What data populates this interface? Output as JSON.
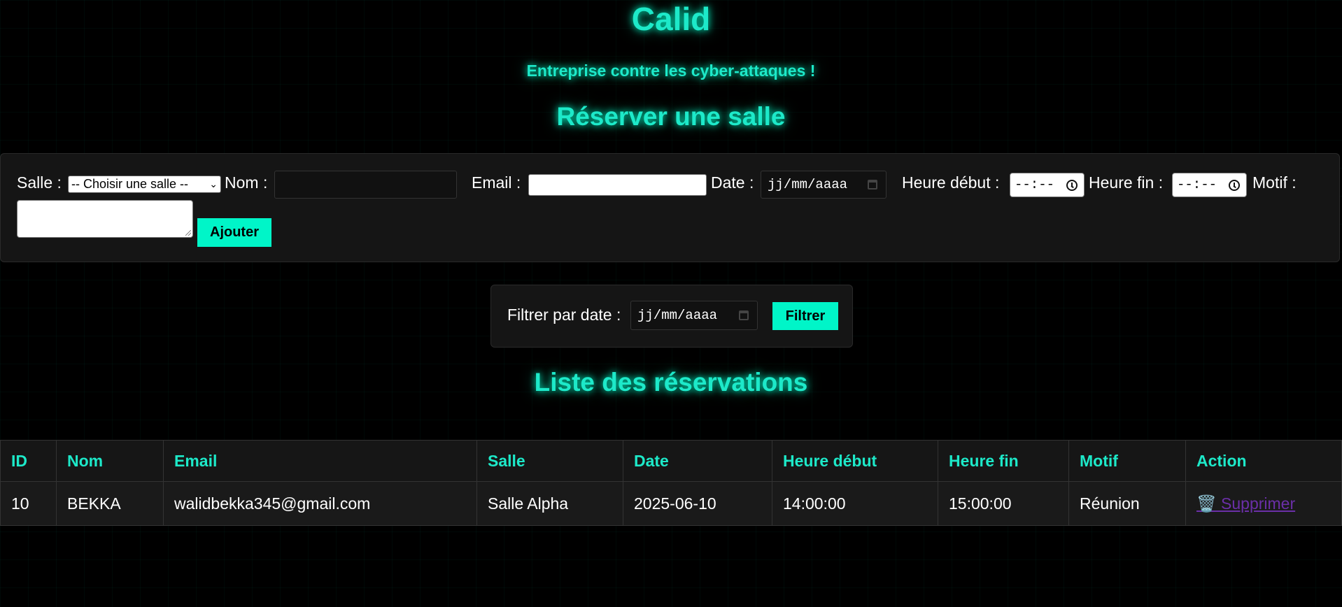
{
  "header": {
    "title": "Calid",
    "subtitle": "Entreprise contre les cyber-attaques !",
    "reserve_heading": "Réserver une salle",
    "list_heading": "Liste des réservations"
  },
  "form": {
    "salle_label": "Salle :",
    "salle_selected": "-- Choisir une salle --",
    "nom_label": "Nom :",
    "nom_value": "",
    "email_label": "Email :",
    "email_value": "",
    "date_label": "Date :",
    "date_placeholder": "jj/mm/aaaa",
    "heure_debut_label": "Heure début :",
    "heure_debut_placeholder": "--:--",
    "heure_fin_label": "Heure fin :",
    "heure_fin_placeholder": "--:--",
    "motif_label": "Motif :",
    "motif_value": "",
    "submit_label": "Ajouter"
  },
  "filter": {
    "label": "Filtrer par date :",
    "date_placeholder": "jj/mm/aaaa",
    "button_label": "Filtrer"
  },
  "table": {
    "headers": [
      "ID",
      "Nom",
      "Email",
      "Salle",
      "Date",
      "Heure début",
      "Heure fin",
      "Motif",
      "Action"
    ],
    "rows": [
      {
        "id": "10",
        "nom": "BEKKA",
        "email": "walidbekka345@gmail.com",
        "salle": "Salle Alpha",
        "date": "2025-06-10",
        "heure_debut": "14:00:00",
        "heure_fin": "15:00:00",
        "motif": "Réunion",
        "action_icon": "trash-icon",
        "action_label": "🗑️ Supprimer"
      }
    ]
  },
  "colors": {
    "accent": "#00f5c8",
    "heading_glow": "#1de9c9",
    "background": "#000000",
    "panel": "#151515",
    "link_visited": "#6b2fa8"
  }
}
